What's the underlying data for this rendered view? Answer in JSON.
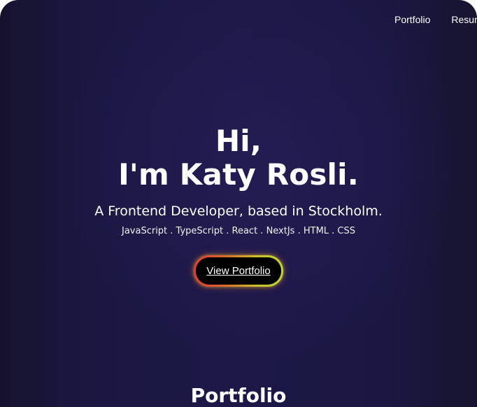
{
  "nav": {
    "items": [
      {
        "label": "Portfolio"
      },
      {
        "label": "Resume"
      }
    ]
  },
  "hero": {
    "greeting_line1": "Hi,",
    "greeting_line2": "I'm Katy Rosli.",
    "tagline": "A Frontend Developer, based in Stockholm.",
    "skills": "JavaScript . TypeScript . React . NextJs . HTML . CSS",
    "cta_label": "View Portfolio"
  },
  "sections": {
    "portfolio_title": "Portfolio"
  },
  "colors": {
    "background": "#1d1846",
    "text": "#ffffff",
    "button_bg": "#000000",
    "button_border_start": "#e03a3a",
    "button_border_end": "#b9d633"
  }
}
